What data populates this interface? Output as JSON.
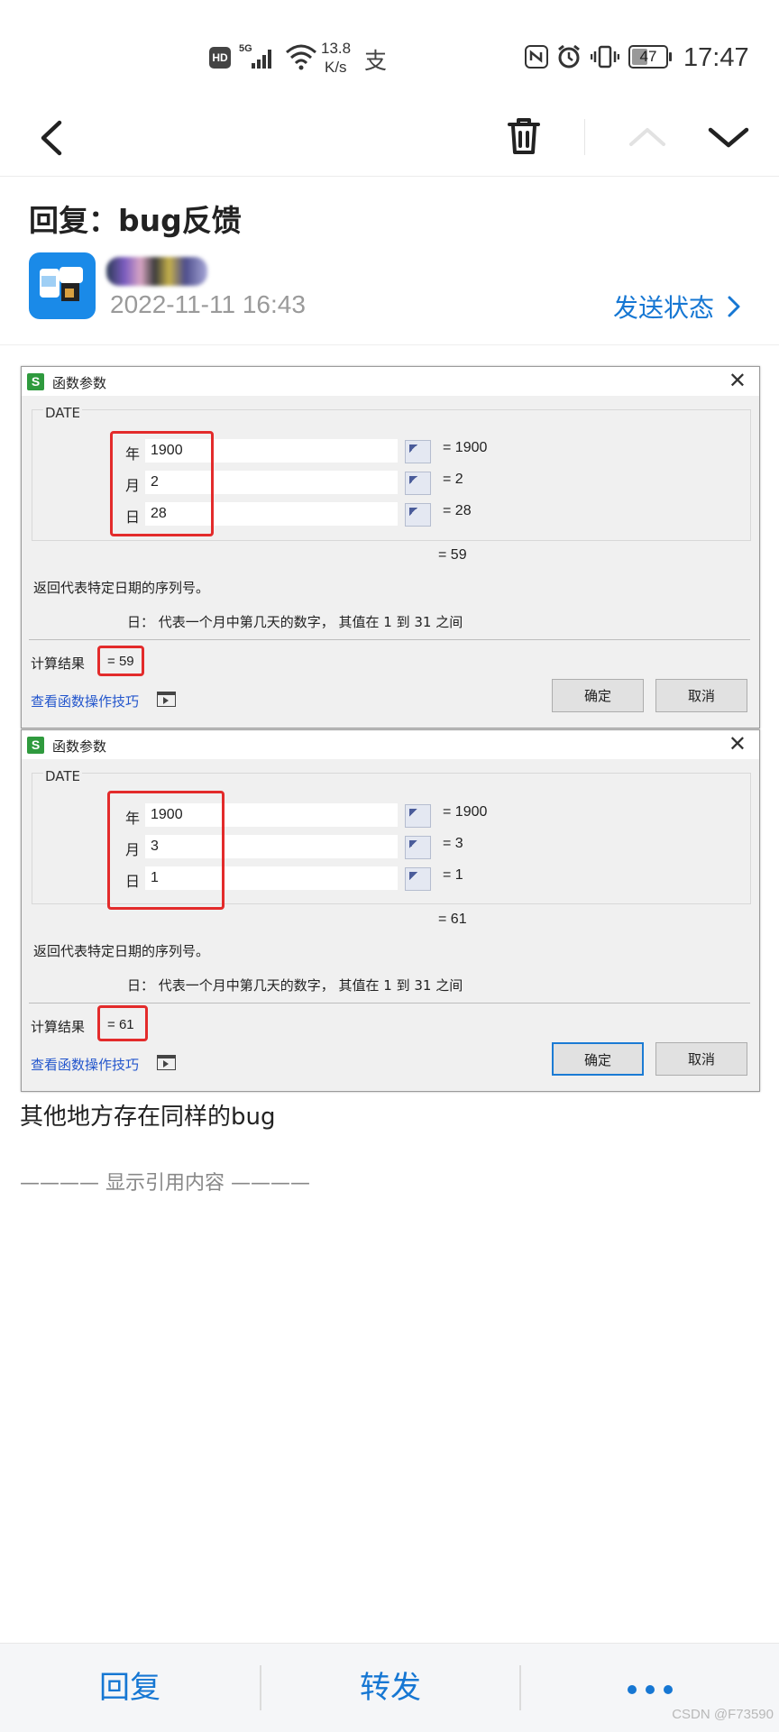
{
  "status_bar": {
    "left_icons": [
      "hd-icon",
      "signal-5g-icon",
      "wifi-icon",
      "alipay-icon"
    ],
    "net_speed_value": "13.8",
    "net_speed_unit": "K/s",
    "right_icons": [
      "nfc-icon",
      "alarm-icon",
      "vibrate-icon"
    ],
    "battery": "47",
    "time": "17:47"
  },
  "nav": {
    "back_icon": "chevron-left-icon",
    "delete_icon": "trash-icon",
    "prev_icon": "chevron-up-icon",
    "next_icon": "chevron-down-icon"
  },
  "email": {
    "subject": "回复：bug反馈",
    "date": "2022-11-11 16:43",
    "send_status": "发送状态"
  },
  "dialogs": [
    {
      "title": "函数参数",
      "app_icon": "S",
      "function_name": "DATE",
      "rows": [
        {
          "label": "年",
          "value": "1900",
          "result": "1900"
        },
        {
          "label": "月",
          "value": "2",
          "result": "2"
        },
        {
          "label": "日",
          "value": "28",
          "result": "28"
        }
      ],
      "total": "= 59",
      "description": "返回代表特定日期的序列号。",
      "param_description": "日：  代表一个月中第几天的数字， 其值在 1 到 31 之间",
      "calc_label": "计算结果",
      "calc_value": "59",
      "tips_link": "查看函数操作技巧",
      "ok_label": "确定",
      "cancel_label": "取消"
    },
    {
      "title": "函数参数",
      "app_icon": "S",
      "function_name": "DATE",
      "rows": [
        {
          "label": "年",
          "value": "1900",
          "result": "1900"
        },
        {
          "label": "月",
          "value": "3",
          "result": "3"
        },
        {
          "label": "日",
          "value": "1",
          "result": "1"
        }
      ],
      "total": "= 61",
      "description": "返回代表特定日期的序列号。",
      "param_description": "日：  代表一个月中第几天的数字， 其值在 1 到 31 之间",
      "calc_label": "计算结果",
      "calc_value": "61",
      "tips_link": "查看函数操作技巧",
      "ok_label": "确定",
      "cancel_label": "取消"
    }
  ],
  "body_text": "其他地方存在同样的bug",
  "quote_toggle": "———— 显示引用内容 ————",
  "bottom_bar": {
    "reply": "回复",
    "forward": "转发",
    "more_icon": "more-dots-icon"
  },
  "watermark": "CSDN @F73590",
  "colors": {
    "accent": "#1677d3",
    "highlight_box": "#e32b2b",
    "dialog_bg": "#f0f0f0"
  }
}
